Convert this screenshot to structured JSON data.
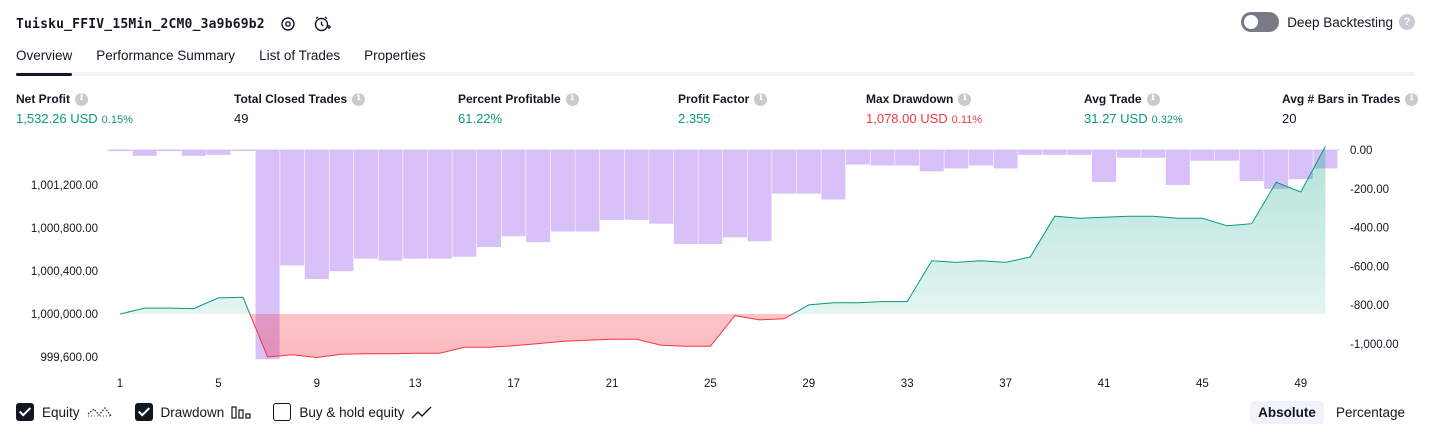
{
  "strategy": {
    "title": "Tuisku_FFIV_15Min_2CM0_3a9b69b2"
  },
  "header_icons": [
    "settings-icon",
    "add-alert-icon"
  ],
  "deep_backtesting": {
    "label": "Deep Backtesting",
    "enabled": false,
    "help_icon": "question-icon"
  },
  "tabs": [
    {
      "label": "Overview",
      "active": true
    },
    {
      "label": "Performance Summary",
      "active": false
    },
    {
      "label": "List of Trades",
      "active": false
    },
    {
      "label": "Properties",
      "active": false
    }
  ],
  "metrics": [
    {
      "label": "Net Profit",
      "value": "1,532.26 USD",
      "pct": "0.15%",
      "color": "#089981"
    },
    {
      "label": "Total Closed Trades",
      "value": "49",
      "pct": "",
      "color": "#131722"
    },
    {
      "label": "Percent Profitable",
      "value": "61.22%",
      "pct": "",
      "color": "#089981"
    },
    {
      "label": "Profit Factor",
      "value": "2.355",
      "pct": "",
      "color": "#089981"
    },
    {
      "label": "Max Drawdown",
      "value": "1,078.00 USD",
      "pct": "0.11%",
      "color": "#f23645"
    },
    {
      "label": "Avg Trade",
      "value": "31.27 USD",
      "pct": "0.32%",
      "color": "#089981"
    },
    {
      "label": "Avg # Bars in Trades",
      "value": "20",
      "pct": "",
      "color": "#131722"
    }
  ],
  "chart_data": {
    "type": "line",
    "x_ticks": [
      "1",
      "5",
      "9",
      "13",
      "17",
      "21",
      "25",
      "29",
      "33",
      "37",
      "41",
      "45",
      "49"
    ],
    "left_axis": {
      "ticks": [
        "1,001,200.00",
        "1,000,800.00",
        "1,000,400.00",
        "1,000,000.00",
        "999,600.00"
      ],
      "baseline": 1000000
    },
    "right_axis": {
      "ticks": [
        "0.00",
        "-200.00",
        "-400.00",
        "-600.00",
        "-800.00",
        "-1,000.00"
      ]
    },
    "x": [
      1,
      2,
      3,
      4,
      5,
      6,
      7,
      8,
      9,
      10,
      11,
      12,
      13,
      14,
      15,
      16,
      17,
      18,
      19,
      20,
      21,
      22,
      23,
      24,
      25,
      26,
      27,
      28,
      29,
      30,
      31,
      32,
      33,
      34,
      35,
      36,
      37,
      38,
      39,
      40,
      41,
      42,
      43,
      44,
      45,
      46,
      47,
      48,
      49,
      50
    ],
    "series": [
      {
        "name": "Equity",
        "color": "#089981",
        "values": [
          1000000,
          1000055,
          1000055,
          1000050,
          1000150,
          1000155,
          999600,
          999620,
          999595,
          999625,
          999630,
          999630,
          999635,
          999635,
          999690,
          999690,
          999705,
          999725,
          999745,
          999755,
          999765,
          999765,
          999710,
          999700,
          999700,
          999985,
          999945,
          999955,
          1000085,
          1000105,
          1000105,
          1000115,
          1000115,
          1000495,
          1000480,
          1000495,
          1000480,
          1000530,
          1000910,
          1000890,
          1000900,
          1000910,
          1000910,
          1000890,
          1000890,
          1000820,
          1000840,
          1001225,
          1001135,
          1001560
        ]
      },
      {
        "name": "Drawdown",
        "color": "#c9a7f7",
        "values": [
          -5,
          -30,
          -5,
          -30,
          -25,
          -5,
          -1078,
          -595,
          -665,
          -625,
          -560,
          -570,
          -560,
          -560,
          -550,
          -500,
          -445,
          -475,
          -420,
          -420,
          -360,
          -360,
          -380,
          -485,
          -485,
          -450,
          -470,
          -225,
          -225,
          -255,
          -75,
          -80,
          -80,
          -110,
          -95,
          -80,
          -95,
          -25,
          -25,
          -25,
          -165,
          -40,
          -40,
          -180,
          -55,
          -55,
          -160,
          -200,
          -150,
          -95
        ]
      }
    ],
    "grid": false
  },
  "legend": [
    {
      "label": "Equity",
      "checked": true,
      "icon": "equity-line-icon"
    },
    {
      "label": "Drawdown",
      "checked": true,
      "icon": "drawdown-bars-icon"
    },
    {
      "label": "Buy & hold equity",
      "checked": false,
      "icon": "buy-hold-line-icon"
    }
  ],
  "mode": {
    "absolute": "Absolute",
    "percentage": "Percentage",
    "selected": "Absolute"
  }
}
